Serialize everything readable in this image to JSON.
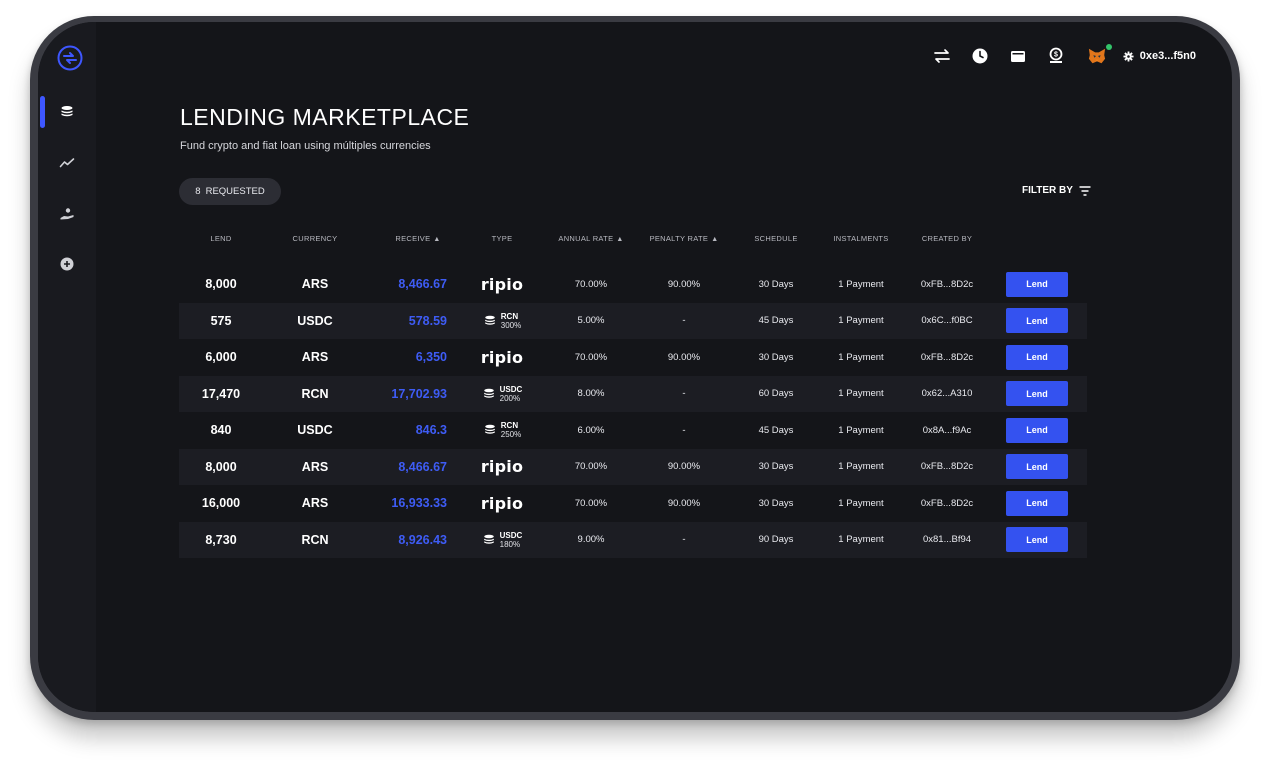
{
  "header": {
    "account": "0xe3...f5n0"
  },
  "page": {
    "title": "LENDING MARKETPLACE",
    "subtitle": "Fund crypto and fiat loan using múltiples currencies"
  },
  "requested": {
    "count": "8",
    "label": "REQUESTED"
  },
  "filter": {
    "label": "FILTER BY"
  },
  "columns": {
    "lend": "LEND",
    "currency": "CURRENCY",
    "receive": "RECEIVE",
    "type": "TYPE",
    "annual_rate": "ANNUAL RATE",
    "penalty_rate": "PENALTY RATE",
    "schedule": "SCHEDULE",
    "instalments": "INSTALMENTS",
    "created_by": "CREATED BY"
  },
  "rows": [
    {
      "lend": "8,000",
      "currency": "ARS",
      "receive": "8,466.67",
      "type": "ripio",
      "type_currency": "",
      "type_pct": "",
      "annual": "70.00%",
      "penalty": "90.00%",
      "schedule": "30 Days",
      "instalments": "1 Payment",
      "created_by": "0xFB...8D2c",
      "action": "Lend"
    },
    {
      "lend": "575",
      "currency": "USDC",
      "receive": "578.59",
      "type": "coins",
      "type_currency": "RCN",
      "type_pct": "300%",
      "annual": "5.00%",
      "penalty": "-",
      "schedule": "45 Days",
      "instalments": "1 Payment",
      "created_by": "0x6C...f0BC",
      "action": "Lend"
    },
    {
      "lend": "6,000",
      "currency": "ARS",
      "receive": "6,350",
      "type": "ripio",
      "type_currency": "",
      "type_pct": "",
      "annual": "70.00%",
      "penalty": "90.00%",
      "schedule": "30 Days",
      "instalments": "1 Payment",
      "created_by": "0xFB...8D2c",
      "action": "Lend"
    },
    {
      "lend": "17,470",
      "currency": "RCN",
      "receive": "17,702.93",
      "type": "coins",
      "type_currency": "USDC",
      "type_pct": "200%",
      "annual": "8.00%",
      "penalty": "-",
      "schedule": "60 Days",
      "instalments": "1 Payment",
      "created_by": "0x62...A310",
      "action": "Lend"
    },
    {
      "lend": "840",
      "currency": "USDC",
      "receive": "846.3",
      "type": "coins",
      "type_currency": "RCN",
      "type_pct": "250%",
      "annual": "6.00%",
      "penalty": "-",
      "schedule": "45 Days",
      "instalments": "1 Payment",
      "created_by": "0x8A...f9Ac",
      "action": "Lend"
    },
    {
      "lend": "8,000",
      "currency": "ARS",
      "receive": "8,466.67",
      "type": "ripio",
      "type_currency": "",
      "type_pct": "",
      "annual": "70.00%",
      "penalty": "90.00%",
      "schedule": "30 Days",
      "instalments": "1 Payment",
      "created_by": "0xFB...8D2c",
      "action": "Lend"
    },
    {
      "lend": "16,000",
      "currency": "ARS",
      "receive": "16,933.33",
      "type": "ripio",
      "type_currency": "",
      "type_pct": "",
      "annual": "70.00%",
      "penalty": "90.00%",
      "schedule": "30 Days",
      "instalments": "1 Payment",
      "created_by": "0xFB...8D2c",
      "action": "Lend"
    },
    {
      "lend": "8,730",
      "currency": "RCN",
      "receive": "8,926.43",
      "type": "coins",
      "type_currency": "USDC",
      "type_pct": "180%",
      "annual": "9.00%",
      "penalty": "-",
      "schedule": "90 Days",
      "instalments": "1 Payment",
      "created_by": "0x81...Bf94",
      "action": "Lend"
    }
  ],
  "ripio_label": "ripio",
  "colors": {
    "accent": "#3452f0",
    "receive": "#3e5cf5",
    "background": "#141519",
    "row_alt": "#1c1d23",
    "online": "#33c46a"
  },
  "icons": {
    "sidebar": [
      "coins-icon",
      "chart-line-icon",
      "hand-coin-icon",
      "plus-circle-icon"
    ],
    "topbar": [
      "swap-icon",
      "clock-icon",
      "wallet-icon",
      "deposit-icon",
      "metamask-fox-icon",
      "gear-icon"
    ]
  }
}
